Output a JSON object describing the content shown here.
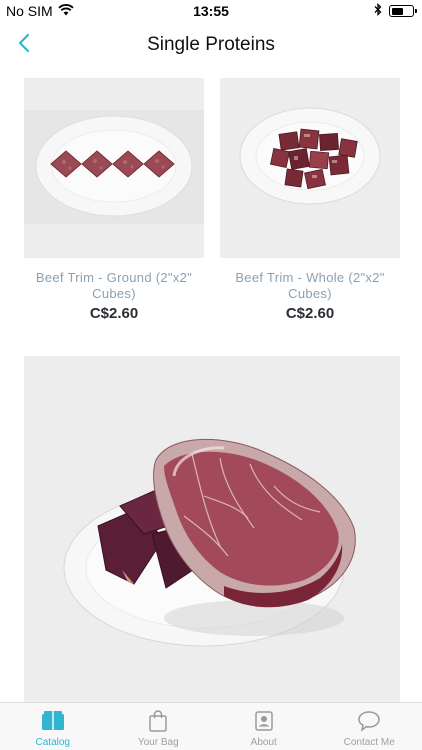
{
  "status_bar": {
    "carrier": "No SIM",
    "time": "13:55",
    "battery_level": 0.6
  },
  "nav": {
    "title": "Single Proteins",
    "back_icon": "chevron-left-icon"
  },
  "products": [
    {
      "name": "Beef Trim - Ground (2\"x2\" Cubes)",
      "price": "C$2.60"
    },
    {
      "name": "Beef Trim - Whole (2\"x2\" Cubes)",
      "price": "C$2.60"
    }
  ],
  "tabs": [
    {
      "label": "Catalog",
      "icon": "catalog-icon",
      "active": true
    },
    {
      "label": "Your Bag",
      "icon": "bag-icon",
      "active": false
    },
    {
      "label": "About",
      "icon": "about-icon",
      "active": false
    },
    {
      "label": "Contact Me",
      "icon": "chat-bubble-icon",
      "active": false
    }
  ],
  "colors": {
    "accent": "#33b5d2",
    "product_name": "#8aa0b4",
    "price": "#2a2e33",
    "card_bg": "#ededed"
  }
}
